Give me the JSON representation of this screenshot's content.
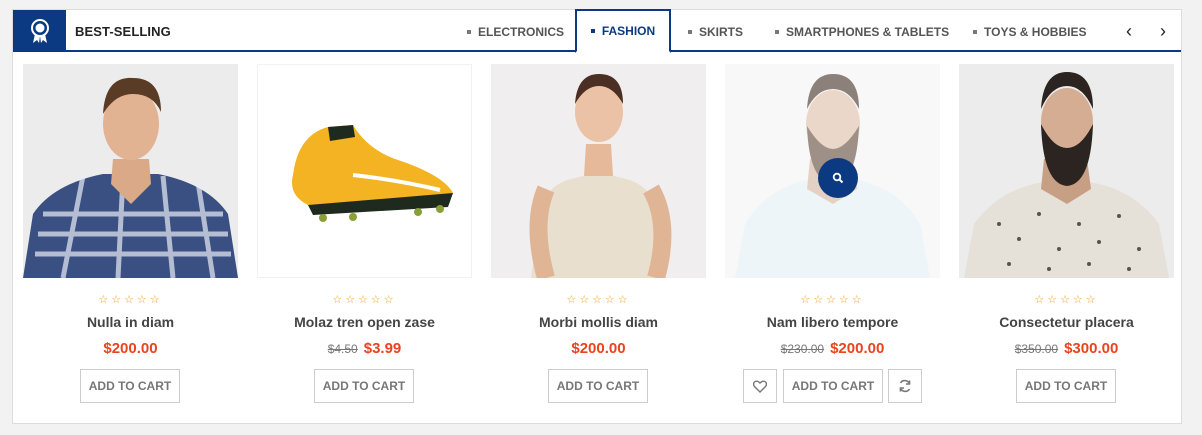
{
  "header": {
    "title": "BEST-SELLING",
    "badge_icon": "award-ribbon-icon",
    "accent_color": "#0b3a82"
  },
  "tabs": [
    {
      "label": "ELECTRONICS",
      "active": false
    },
    {
      "label": "FASHION",
      "active": true
    },
    {
      "label": "SKIRTS",
      "active": false
    },
    {
      "label": "SMARTPHONES & TABLETS",
      "active": false
    },
    {
      "label": "TOYS & HOBBIES",
      "active": false
    }
  ],
  "nav": {
    "prev": "‹",
    "next": "›"
  },
  "products": [
    {
      "name": "Nulla in diam",
      "old_price": "",
      "price": "$200.00",
      "rating": "☆☆☆☆☆",
      "cart_label": "ADD TO CART",
      "image": "man in blue plaid shirt"
    },
    {
      "name": "Molaz tren open zase",
      "old_price": "$4.50",
      "price": "$3.99",
      "rating": "☆☆☆☆☆",
      "cart_label": "ADD TO CART",
      "image": "yellow football boot"
    },
    {
      "name": "Morbi mollis diam",
      "old_price": "",
      "price": "$200.00",
      "rating": "☆☆☆☆☆",
      "cart_label": "ADD TO CART",
      "image": "woman in strapless dress"
    },
    {
      "name": "Nam libero tempore",
      "old_price": "$230.00",
      "price": "$200.00",
      "rating": "☆☆☆☆☆",
      "cart_label": "ADD TO CART",
      "image": "bearded man in white shirt"
    },
    {
      "name": "Consectetur placera",
      "old_price": "$350.00",
      "price": "$300.00",
      "rating": "☆☆☆☆☆",
      "cart_label": "ADD TO CART",
      "image": "bearded man in dotted shirt"
    }
  ],
  "colors": {
    "price": "#e8441f",
    "star": "#f3a019"
  }
}
